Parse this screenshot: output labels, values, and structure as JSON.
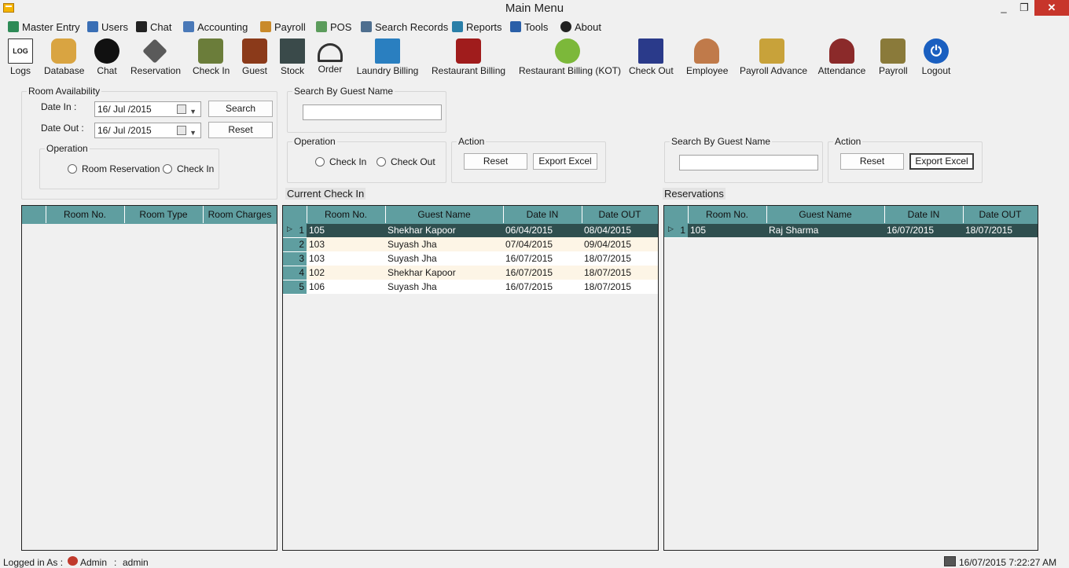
{
  "window": {
    "title": "Main Menu",
    "minimize": "_",
    "maximize": "❐",
    "close": "✕"
  },
  "menu": [
    {
      "label": "Master Entry",
      "color": "#2e8b57"
    },
    {
      "label": "Users",
      "color": "#3a6fb5"
    },
    {
      "label": "Chat",
      "color": "#222222"
    },
    {
      "label": "Accounting",
      "color": "#4a79b8"
    },
    {
      "label": "Payroll",
      "color": "#c98a2b"
    },
    {
      "label": "POS",
      "color": "#5c9c5c"
    },
    {
      "label": "Search Records",
      "color": "#4f6f8f"
    },
    {
      "label": "Reports",
      "color": "#2a7fa8"
    },
    {
      "label": "Tools",
      "color": "#2a5fa8"
    },
    {
      "label": "About",
      "color": "#222222"
    }
  ],
  "toolbar": [
    {
      "label": "Logs",
      "icon": "log-file-icon",
      "color": "#ffffff"
    },
    {
      "label": "Database",
      "icon": "database-icon",
      "color": "#d9a441"
    },
    {
      "label": "Chat",
      "icon": "chat-bubble-icon",
      "color": "#111111"
    },
    {
      "label": "Reservation",
      "icon": "reservation-icon",
      "color": "#5a5a5a"
    },
    {
      "label": "Check In",
      "icon": "check-in-icon",
      "color": "#6b7d3a"
    },
    {
      "label": "Guest",
      "icon": "guest-icon",
      "color": "#8b3a1a"
    },
    {
      "label": "Stock",
      "icon": "stock-icon",
      "color": "#3a4a4a"
    },
    {
      "label": "Order",
      "icon": "order-cloche-icon",
      "color": "#333333"
    },
    {
      "label": "Laundry Billing",
      "icon": "laundry-icon",
      "color": "#2a7fc0"
    },
    {
      "label": "Restaurant Billing",
      "icon": "restaurant-icon",
      "color": "#a01c1c"
    },
    {
      "label": "Restaurant Billing (KOT)",
      "icon": "kot-icon",
      "color": "#7cb83a"
    },
    {
      "label": "Check Out",
      "icon": "check-out-icon",
      "color": "#2a3a8a"
    },
    {
      "label": "Employee",
      "icon": "employee-icon",
      "color": "#c07a4a"
    },
    {
      "label": "Payroll Advance",
      "icon": "payroll-advance-icon",
      "color": "#c8a23a"
    },
    {
      "label": "Attendance",
      "icon": "attendance-icon",
      "color": "#8b2a2a"
    },
    {
      "label": "Payroll",
      "icon": "payroll-icon",
      "color": "#8a7a3a"
    },
    {
      "label": "Logout",
      "icon": "logout-power-icon",
      "color": "#1a5fc0"
    }
  ],
  "room_availability": {
    "title": "Room Availability",
    "date_in_label": "Date In :",
    "date_in_value": "16/ Jul /2015",
    "date_out_label": "Date Out :",
    "date_out_value": "16/ Jul /2015",
    "search_button": "Search",
    "reset_button": "Reset",
    "operation_title": "Operation",
    "radio_room_reservation": "Room Reservation",
    "radio_check_in": "Check In"
  },
  "checkin_search": {
    "search_title": "Search By Guest Name",
    "operation_title": "Operation",
    "radio_check_in": "Check In",
    "radio_check_out": "Check Out",
    "action_title": "Action",
    "reset_button": "Reset",
    "export_button": "Export Excel"
  },
  "reservation_search": {
    "search_title": "Search By Guest Name",
    "action_title": "Action",
    "reset_button": "Reset",
    "export_button": "Export Excel"
  },
  "rooms_grid": {
    "columns": [
      "Room No.",
      "Room Type",
      "Room Charges"
    ]
  },
  "current_checkin": {
    "label": "Current Check In",
    "columns": [
      "Room No.",
      "Guest Name",
      "Date IN",
      "Date OUT"
    ],
    "rows": [
      {
        "n": "1",
        "room": "105",
        "guest": "Shekhar Kapoor",
        "in": "06/04/2015",
        "out": "08/04/2015"
      },
      {
        "n": "2",
        "room": "103",
        "guest": "Suyash Jha",
        "in": "07/04/2015",
        "out": "09/04/2015"
      },
      {
        "n": "3",
        "room": "103",
        "guest": "Suyash Jha",
        "in": "16/07/2015",
        "out": "18/07/2015"
      },
      {
        "n": "4",
        "room": "102",
        "guest": "Shekhar Kapoor",
        "in": "16/07/2015",
        "out": "18/07/2015"
      },
      {
        "n": "5",
        "room": "106",
        "guest": "Suyash Jha",
        "in": "16/07/2015",
        "out": "18/07/2015"
      }
    ]
  },
  "reservations": {
    "label": "Reservations",
    "columns": [
      "Room No.",
      "Guest Name",
      "Date IN",
      "Date OUT"
    ],
    "rows": [
      {
        "n": "1",
        "room": "105",
        "guest": "Raj Sharma",
        "in": "16/07/2015",
        "out": "18/07/2015"
      }
    ]
  },
  "status": {
    "logged_in_label": "Logged in As :",
    "role": "Admin",
    "separator": ":",
    "user": "admin",
    "datetime": "16/07/2015 7:22:27 AM"
  }
}
